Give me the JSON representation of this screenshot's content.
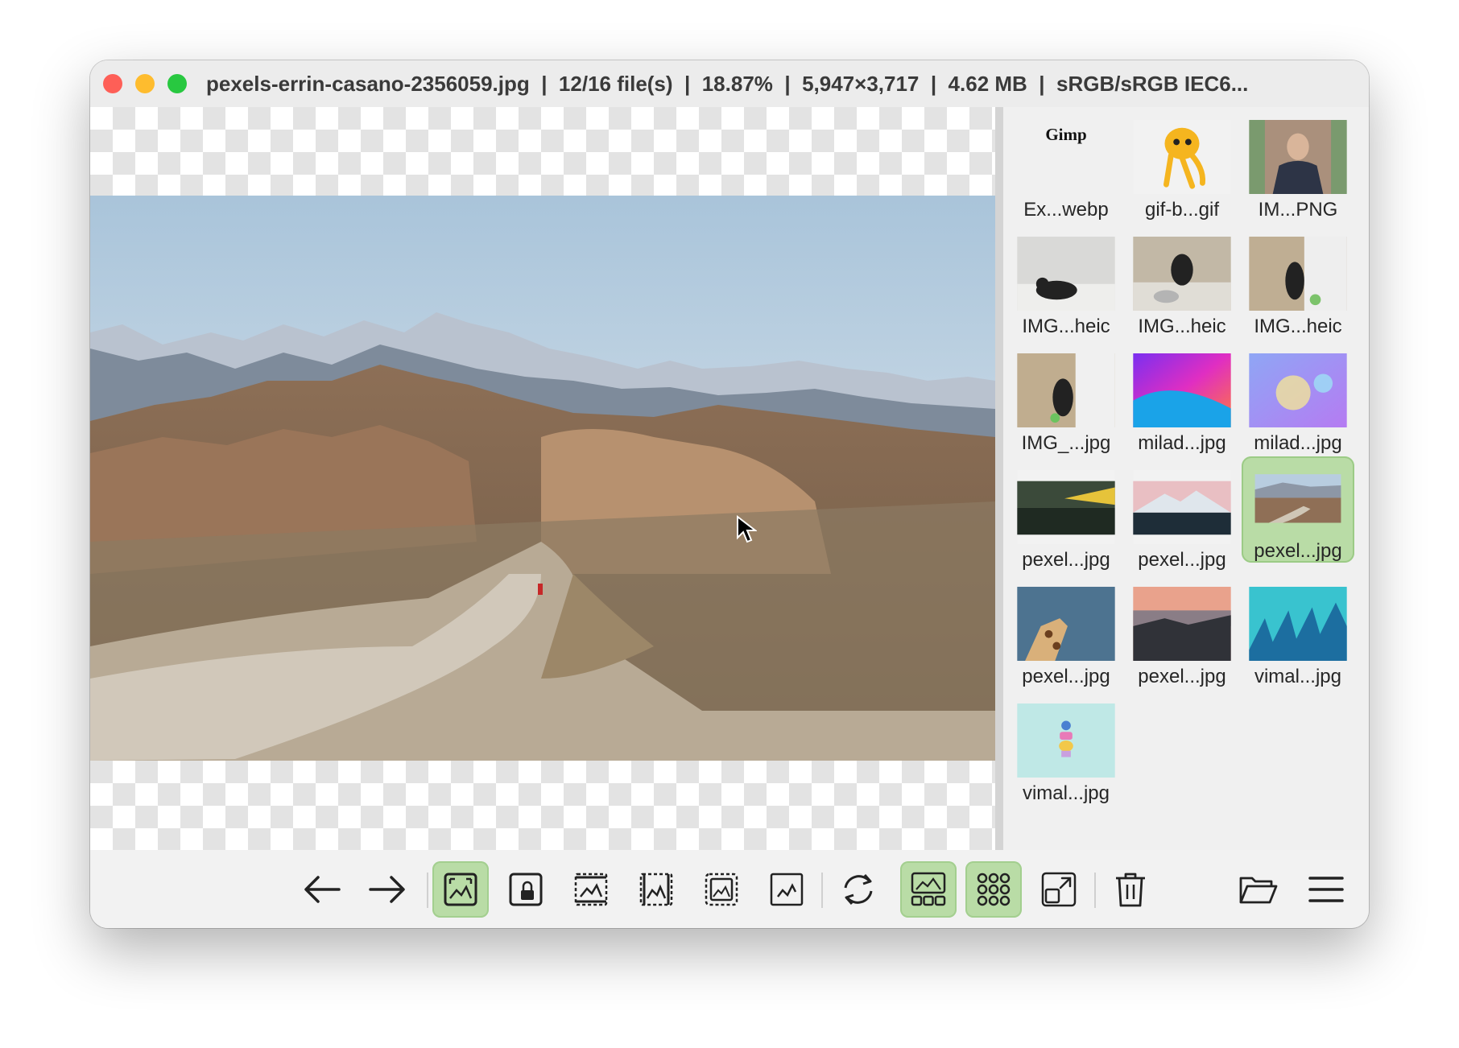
{
  "window": {
    "title": "pexels-errin-casano-2356059.jpg  |  12/16 file(s)  |  18.87%  |  5,947×3,717  |  4.62 MB  |  sRGB/sRGB IEC6..."
  },
  "thumbnails": [
    {
      "label": "Ex...webp",
      "image_text": "Gimp"
    },
    {
      "label": "gif-b...gif"
    },
    {
      "label": "IM...PNG"
    },
    {
      "label": "IMG...heic"
    },
    {
      "label": "IMG...heic"
    },
    {
      "label": "IMG...heic"
    },
    {
      "label": "IMG_...jpg"
    },
    {
      "label": "milad...jpg"
    },
    {
      "label": "milad...jpg"
    },
    {
      "label": "pexel...jpg"
    },
    {
      "label": "pexel...jpg"
    },
    {
      "label": "pexel...jpg",
      "selected": true
    },
    {
      "label": "pexel...jpg"
    },
    {
      "label": "pexel...jpg"
    },
    {
      "label": "vimal...jpg"
    },
    {
      "label": "vimal...jpg"
    }
  ],
  "toolbar": {
    "buttons": [
      {
        "icon": "arrow-left-icon",
        "active": false
      },
      {
        "icon": "arrow-right-icon",
        "active": false
      },
      {
        "icon": "fit-window-icon",
        "active": true
      },
      {
        "icon": "lock-zoom-icon",
        "active": false
      },
      {
        "icon": "fit-width-icon",
        "active": false
      },
      {
        "icon": "fit-height-icon",
        "active": false
      },
      {
        "icon": "fill-window-icon",
        "active": false
      },
      {
        "icon": "original-size-icon",
        "active": false
      },
      {
        "icon": "refresh-icon",
        "active": false
      },
      {
        "icon": "thumbnail-bar-icon",
        "active": true
      },
      {
        "icon": "gallery-grid-icon",
        "active": true
      },
      {
        "icon": "open-external-icon",
        "active": false
      },
      {
        "icon": "trash-icon",
        "active": false
      },
      {
        "icon": "folder-open-icon",
        "active": false
      },
      {
        "icon": "menu-icon",
        "active": false
      }
    ]
  },
  "colors": {
    "active_button": "#b9dca6",
    "titlebar": "#ececec"
  }
}
